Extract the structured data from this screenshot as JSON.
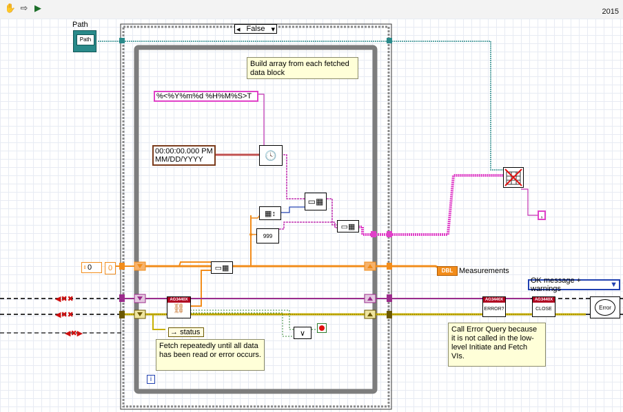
{
  "toolbar": {
    "tools": [
      "hand-icon",
      "arrow-right-icon",
      "run-highlight-icon"
    ],
    "version": "2015"
  },
  "controls": {
    "path_label": "Path",
    "path_icon_text": "Path",
    "numeric_value": "0",
    "numeric_index": "0",
    "timestamp_line1": "00:00:00.000 PM",
    "timestamp_line2": "MM/DD/YYYY",
    "format_string": "%<%Y%m%d %H%M%S>T",
    "delimiter": ",",
    "case_selector": "False",
    "status_label": "status",
    "measurements_label": "Measurements",
    "measurements_type": "DBL",
    "error_dialog_option": "OK message + warnings",
    "iteration_terminal": "i"
  },
  "notes": {
    "build_array": "Build array from each fetched data block",
    "fetch_repeatedly": "Fetch repeatedly until all data has been read or error occurs.",
    "call_error_query": "Call Error Query because it is not called in the low-level Initiate and Fetch VIs."
  },
  "subvis": {
    "fetch_tag": "AG3440X",
    "error_query_tag": "AG3440X",
    "error_query_text": "ERROR?",
    "close_tag": "AG3440X",
    "close_text": "CLOSE",
    "error_handler_text": "Error"
  },
  "colors": {
    "orange_wire": "#f28c1a",
    "pink_wire": "#e040c8",
    "teal_wire": "#2a8a8a",
    "error_wire": "#a08000",
    "frame_gray": "#7d7d7d",
    "stop_red": "#e01010"
  }
}
